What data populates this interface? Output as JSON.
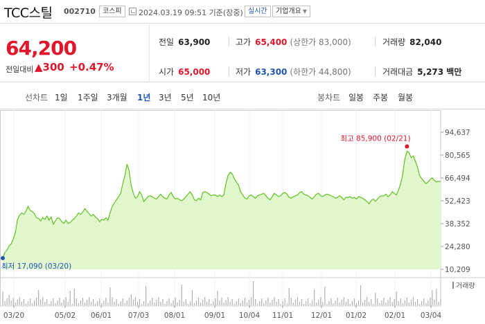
{
  "header": {
    "stock_name": "TCC스틸",
    "stock_code": "002710",
    "market": "코스피",
    "timestamp": "2024.03.19 09:51 기준(장중)",
    "realtime_label": "실시간",
    "company_button": "기업개요"
  },
  "price": {
    "current": "64,200",
    "change_label": "전일대비",
    "change_symbol": "▲",
    "change_amount": "300",
    "change_percent": "+0.47%"
  },
  "stats": {
    "prev_close": {
      "label": "전일",
      "value": "63,900"
    },
    "high": {
      "label": "고가",
      "value": "65,400",
      "sub": "(상한가 83,000)"
    },
    "volume": {
      "label": "거래량",
      "value": "82,040"
    },
    "open": {
      "label": "시가",
      "value": "65,000"
    },
    "low": {
      "label": "저가",
      "value": "63,300",
      "sub": "(하한가 44,800)"
    },
    "trade_value": {
      "label": "거래대금",
      "value": "5,273 백만"
    }
  },
  "tabs": {
    "line_label": "선차트",
    "line_items": [
      "1일",
      "1주일",
      "3개월",
      "1년",
      "3년",
      "5년",
      "10년"
    ],
    "active": "1년",
    "candle_label": "봉차트",
    "candle_items": [
      "일봉",
      "주봉",
      "월봉"
    ]
  },
  "colors": {
    "up": "#e0162b",
    "down": "#1e56b4",
    "line": "#5cc21e",
    "fill": "#e3f7cf"
  },
  "chart_data": {
    "type": "area",
    "y_ticks": [
      94637,
      80565,
      66494,
      52423,
      38352,
      24280,
      10209
    ],
    "y_tick_labels": [
      "94,637",
      "80,565",
      "66,494",
      "52,423",
      "38,352",
      "24,280",
      "10,209"
    ],
    "ylim": [
      10209,
      94637
    ],
    "x_tick_labels": [
      "03/20",
      "05/02",
      "06/01",
      "07/03",
      "08/01",
      "09/01",
      "10/04",
      "11/01",
      "12/01",
      "01/02",
      "02/01",
      "03/04"
    ],
    "max_annotation": {
      "label": "최고 85,900 (02/21)",
      "value": 85900
    },
    "min_annotation": {
      "label": "최저 17,090 (03/20)",
      "value": 17090
    },
    "volume_legend": "거래량",
    "series": [
      {
        "values": [
          17090,
          20500,
          22000,
          24500,
          26000,
          29000,
          33000,
          41000,
          43500,
          45000,
          44000,
          46000,
          49000,
          46500,
          45800,
          44500,
          42000,
          41500,
          40000,
          42000,
          41000,
          43000,
          40500,
          42500,
          38000,
          40000,
          42000,
          41500,
          39500,
          38500,
          40500,
          38500,
          39000,
          40500,
          41500,
          43000,
          45000,
          44000,
          45500,
          47500,
          46000,
          44500,
          43000,
          44000,
          42500,
          41500,
          39500,
          41000,
          40500,
          42000,
          40500,
          45000,
          49000,
          51000,
          53000,
          55000,
          57000,
          63000,
          68000,
          75000,
          71000,
          62000,
          57000,
          54000,
          55000,
          58000,
          56000,
          52000,
          53500,
          55000,
          55500,
          55000,
          54000,
          53500,
          55000,
          56500,
          55000,
          54000,
          53500,
          56000,
          57500,
          55000,
          53500,
          54000,
          53000,
          52500,
          53500,
          55000,
          56500,
          58000,
          56000,
          53000,
          52500,
          54000,
          53000,
          57500,
          58000,
          57500,
          56500,
          55500,
          56000,
          56000,
          55000,
          56000,
          55000,
          56000,
          63000,
          68000,
          70000,
          69000,
          66000,
          64000,
          62000,
          58000,
          56000,
          54000,
          53500,
          55500,
          56000,
          55000,
          54000,
          55500,
          56000,
          56500,
          57000,
          55500,
          54000,
          53000,
          55000,
          57000,
          56000,
          55000,
          55500,
          57000,
          57500,
          56500,
          54500,
          54000,
          55000,
          55500,
          56000,
          57500,
          58000,
          56500,
          56000,
          55500,
          54500,
          53500,
          55000,
          56500,
          57000,
          55500,
          55000,
          56000,
          56500,
          56000,
          55500,
          55000,
          54000,
          54500,
          55500,
          54500,
          53000,
          54500,
          54500,
          55000,
          54000,
          54500,
          53500,
          55000,
          54500,
          54000,
          53000,
          52000,
          50500,
          52500,
          53500,
          52000,
          53500,
          55000,
          55500,
          55500,
          56500,
          55000,
          56000,
          58000,
          57000,
          56000,
          59000,
          63000,
          69000,
          78000,
          83000,
          82000,
          79000,
          80000,
          77000,
          73000,
          68000,
          66000,
          64500,
          63000,
          64000,
          65500,
          66500,
          65000,
          64000,
          64500,
          64200
        ]
      }
    ]
  }
}
